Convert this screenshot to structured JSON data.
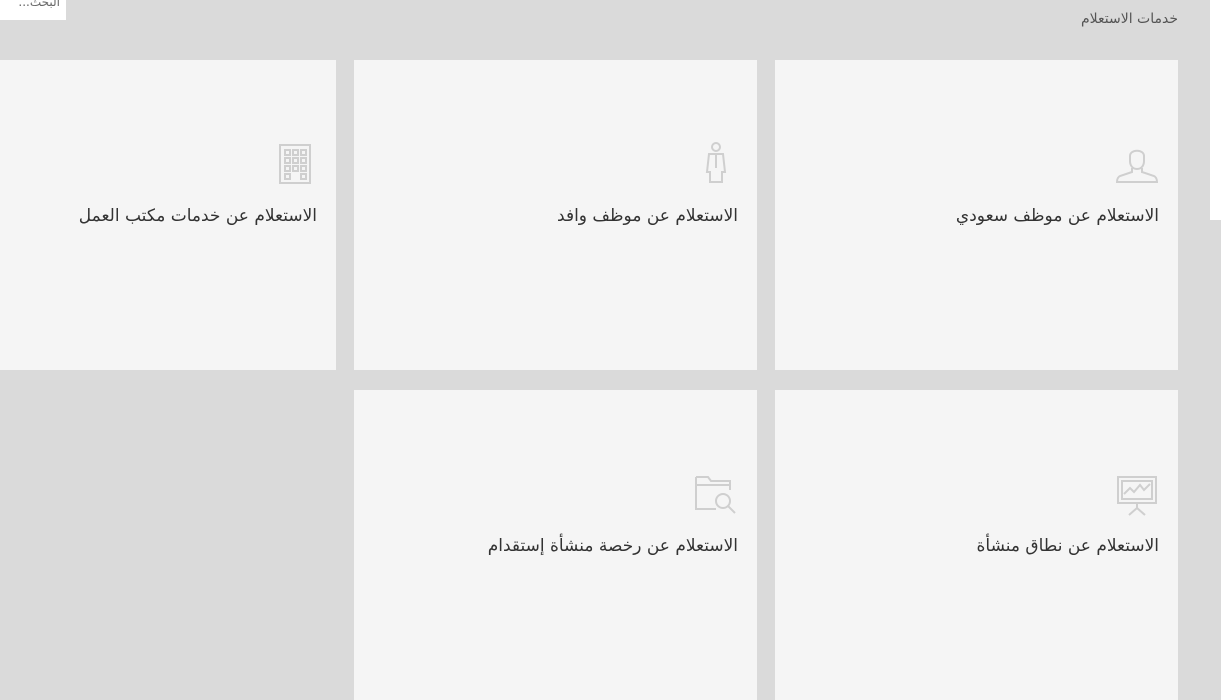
{
  "search": {
    "placeholder": "البحث..."
  },
  "section": {
    "title": "خدمات الاستعلام"
  },
  "cards": [
    {
      "label": "الاستعلام عن موظف سعودي",
      "icon": "user-icon"
    },
    {
      "label": "الاستعلام عن موظف وافد",
      "icon": "worker-icon"
    },
    {
      "label": "الاستعلام عن خدمات مكتب العمل",
      "icon": "building-icon"
    },
    {
      "label": "الاستعلام عن نطاق منشأة",
      "icon": "presentation-chart-icon"
    },
    {
      "label": "الاستعلام عن رخصة منشأة إستقدام",
      "icon": "folder-search-icon"
    }
  ],
  "colors": {
    "background": "#dadada",
    "card": "#f5f5f5",
    "icon": "#cfcfcf",
    "text": "#333333"
  }
}
